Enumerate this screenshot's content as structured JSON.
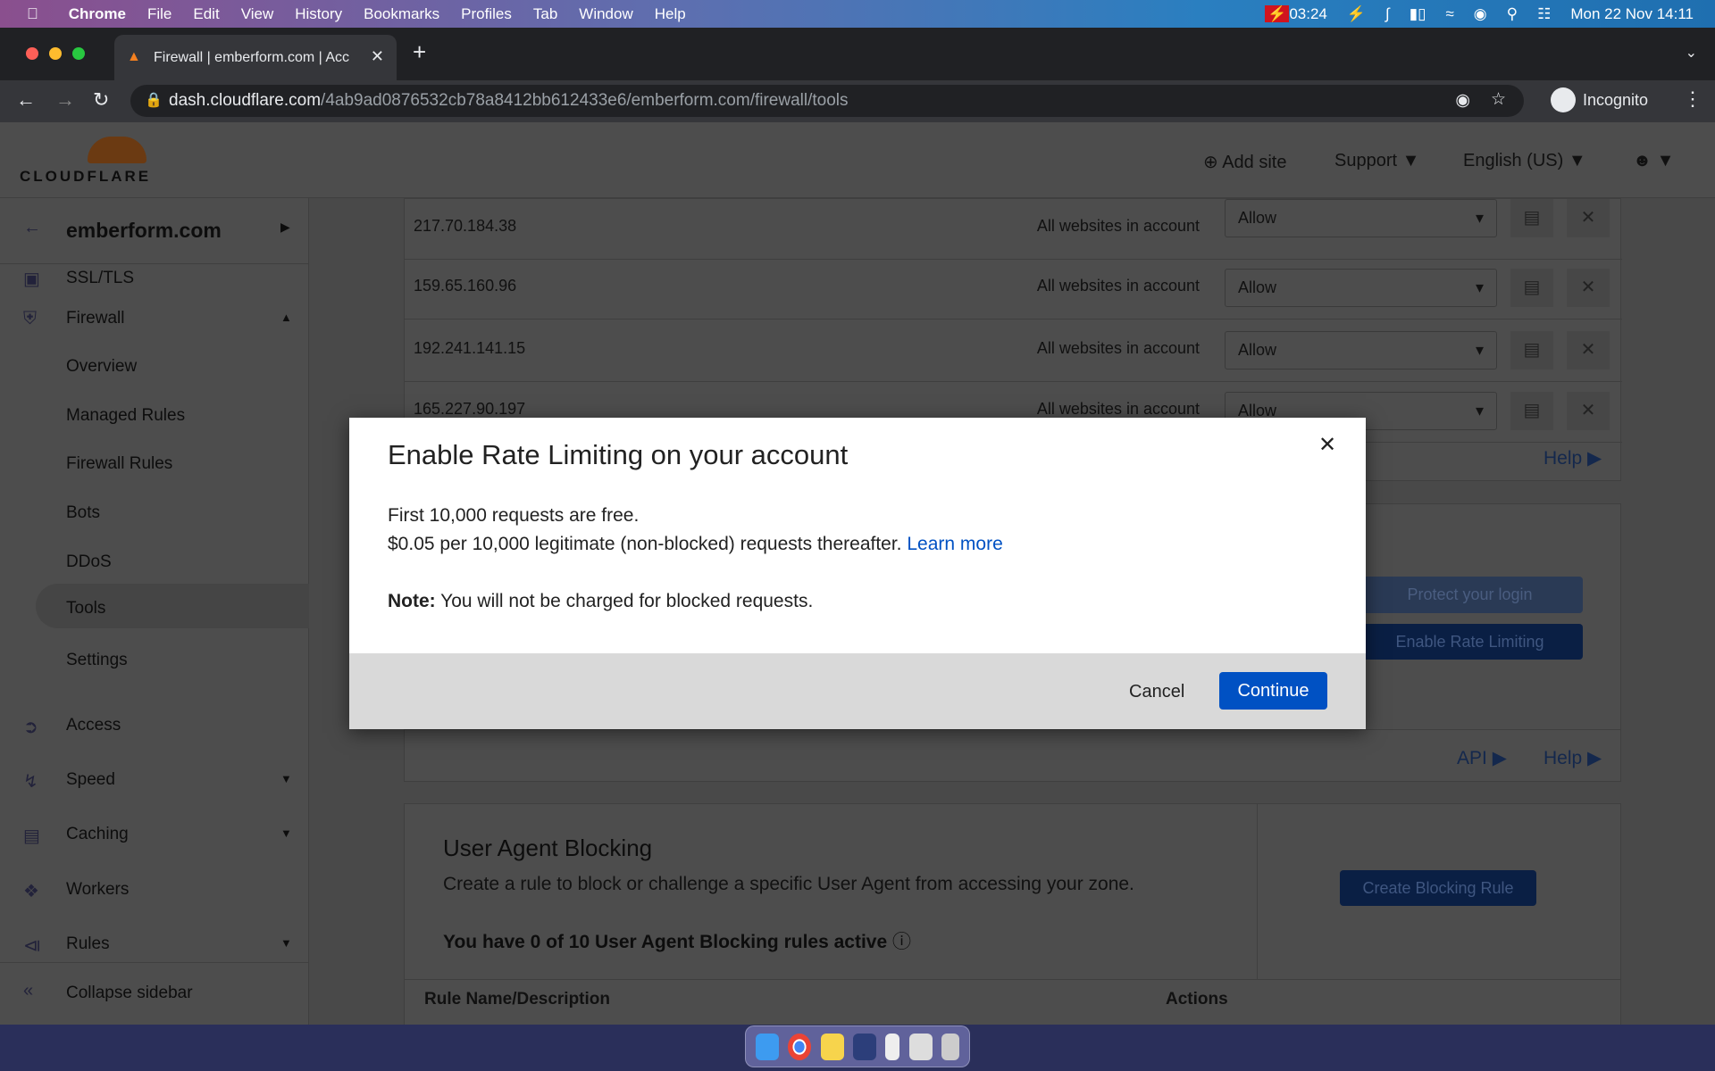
{
  "menubar": {
    "app": "Chrome",
    "items": [
      "File",
      "Edit",
      "View",
      "History",
      "Bookmarks",
      "Profiles",
      "Tab",
      "Window",
      "Help"
    ],
    "timer": "03:24",
    "datetime": "Mon 22 Nov  14:11"
  },
  "browser": {
    "tab_title": "Firewall | emberform.com | Acc",
    "url_host": "dash.cloudflare.com",
    "url_path": "/4ab9ad0876532cb78a8412bb612433e6/emberform.com/firewall/tools",
    "profile": "Incognito"
  },
  "header": {
    "logo": "CLOUDFLARE",
    "add_site": "Add site",
    "support": "Support",
    "language": "English (US)"
  },
  "sidebar": {
    "domain": "emberform.com",
    "partial": "SSL/TLS",
    "firewall": "Firewall",
    "sub": [
      "Overview",
      "Managed Rules",
      "Firewall Rules",
      "Bots",
      "DDoS",
      "Tools",
      "Settings"
    ],
    "selected": "Tools",
    "items": [
      "Access",
      "Speed",
      "Caching",
      "Workers",
      "Rules"
    ],
    "collapse": "Collapse sidebar"
  },
  "ip_rules": [
    {
      "ip": "217.70.184.38",
      "scope": "All websites in account",
      "action": "Allow"
    },
    {
      "ip": "159.65.160.96",
      "scope": "All websites in account",
      "action": "Allow"
    },
    {
      "ip": "192.241.141.15",
      "scope": "All websites in account",
      "action": "Allow"
    },
    {
      "ip": "165.227.90.197",
      "scope": "All websites in account",
      "action": "Allow"
    }
  ],
  "links": {
    "help": "Help",
    "api": "API"
  },
  "rate_limiting": {
    "protect_login": "Protect your login",
    "enable": "Enable Rate Limiting"
  },
  "ua_blocking": {
    "title": "User Agent Blocking",
    "description": "Create a rule to block or challenge a specific User Agent from accessing your zone.",
    "count": "You have 0 of 10 User Agent Blocking rules active",
    "create": "Create Blocking Rule",
    "col_name": "Rule Name/Description",
    "col_actions": "Actions"
  },
  "modal": {
    "title": "Enable Rate Limiting on your account",
    "line1": "First 10,000 requests are free.",
    "line2": "$0.05 per 10,000 legitimate (non-blocked) requests thereafter.",
    "learn_more": "Learn more",
    "note_label": "Note:",
    "note": " You will not be charged for blocked requests.",
    "cancel": "Cancel",
    "continue": "Continue"
  },
  "colors": {
    "accent": "#0051c3",
    "cloudflare_orange": "#f38020"
  }
}
